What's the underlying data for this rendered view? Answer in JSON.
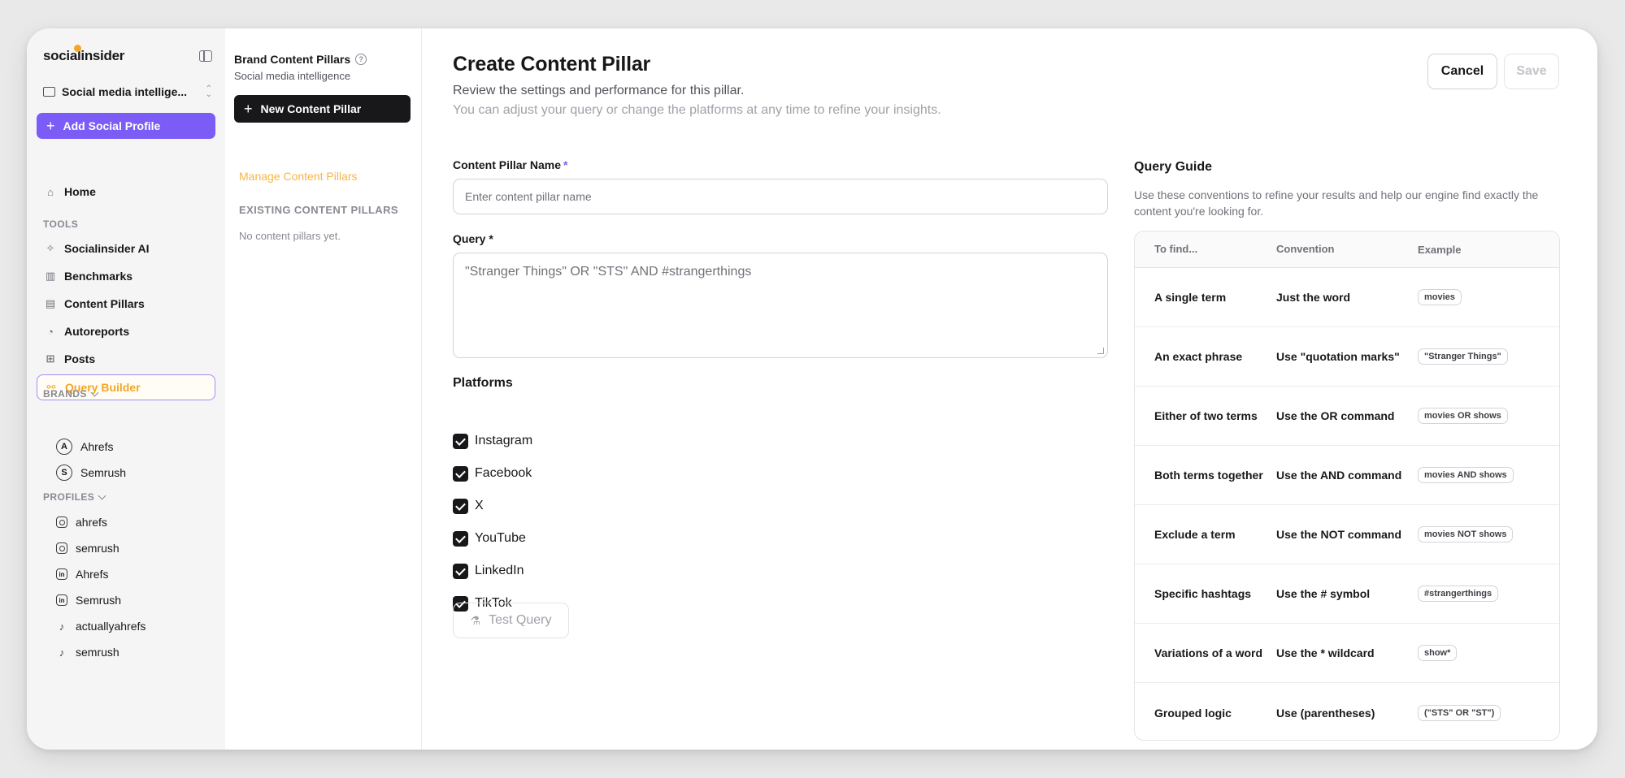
{
  "sidebar": {
    "logo": "socialinsider",
    "workspace": "Social media intellige...",
    "add_profile": "Add Social Profile",
    "home": "Home",
    "tools_label": "TOOLS",
    "tools": [
      "Socialinsider AI",
      "Benchmarks",
      "Content Pillars",
      "Autoreports",
      "Posts",
      "Query Builder"
    ],
    "brands_label": "BRANDS",
    "brands": [
      {
        "initial": "A",
        "name": "Ahrefs"
      },
      {
        "initial": "S",
        "name": "Semrush"
      }
    ],
    "profiles_label": "PROFILES",
    "profiles": [
      {
        "network": "instagram",
        "name": "ahrefs"
      },
      {
        "network": "instagram",
        "name": "semrush"
      },
      {
        "network": "linkedin",
        "name": "Ahrefs"
      },
      {
        "network": "linkedin",
        "name": "Semrush"
      },
      {
        "network": "tiktok",
        "name": "actuallyahrefs"
      },
      {
        "network": "tiktok",
        "name": "semrush"
      }
    ]
  },
  "pillars_panel": {
    "title": "Brand Content Pillars",
    "subtitle": "Social media intelligence",
    "new_button": "New Content Pillar",
    "manage_link": "Manage Content Pillars",
    "existing_label": "EXISTING CONTENT PILLARS",
    "empty_text": "No content pillars yet."
  },
  "main": {
    "title": "Create Content Pillar",
    "subtitle1": "Review the settings and performance for this pillar.",
    "subtitle2": "You can adjust your query or change the platforms at any time to refine your insights.",
    "cancel": "Cancel",
    "save": "Save",
    "name_label": "Content Pillar Name",
    "name_placeholder": "Enter content pillar name",
    "query_label": "Query",
    "query_value": "\"Stranger Things\" OR \"STS\" AND #strangerthings",
    "required_mark": "*",
    "platforms_title": "Platforms",
    "platforms": [
      "Instagram",
      "Facebook",
      "X",
      "YouTube",
      "LinkedIn",
      "TikTok"
    ],
    "test_query": "Test Query"
  },
  "guide": {
    "title": "Query Guide",
    "description": "Use these conventions to refine your results and help our engine find exactly the content you're looking for.",
    "headers": [
      "To find...",
      "Convention",
      "Example"
    ],
    "rows": [
      {
        "find": "A single term",
        "convention": "Just the word",
        "example": "movies"
      },
      {
        "find": "An exact phrase",
        "convention": "Use \"quotation marks\"",
        "example": "\"Stranger Things\""
      },
      {
        "find": "Either of two terms",
        "convention": "Use the OR command",
        "example": "movies OR shows"
      },
      {
        "find": "Both terms together",
        "convention": "Use the AND command",
        "example": "movies AND shows"
      },
      {
        "find": "Exclude a term",
        "convention": "Use the NOT command",
        "example": "movies NOT shows"
      },
      {
        "find": "Specific hashtags",
        "convention": "Use the # symbol",
        "example": "#strangerthings"
      },
      {
        "find": "Variations of a word",
        "convention": "Use the * wildcard",
        "example": "show*"
      },
      {
        "find": "Grouped logic",
        "convention": "Use (parentheses)",
        "example": "(\"STS\" OR \"ST\")"
      }
    ]
  },
  "colors": {
    "accent_purple": "#7c5cf7",
    "active_orange": "#f5a623",
    "dark": "#18181b"
  }
}
